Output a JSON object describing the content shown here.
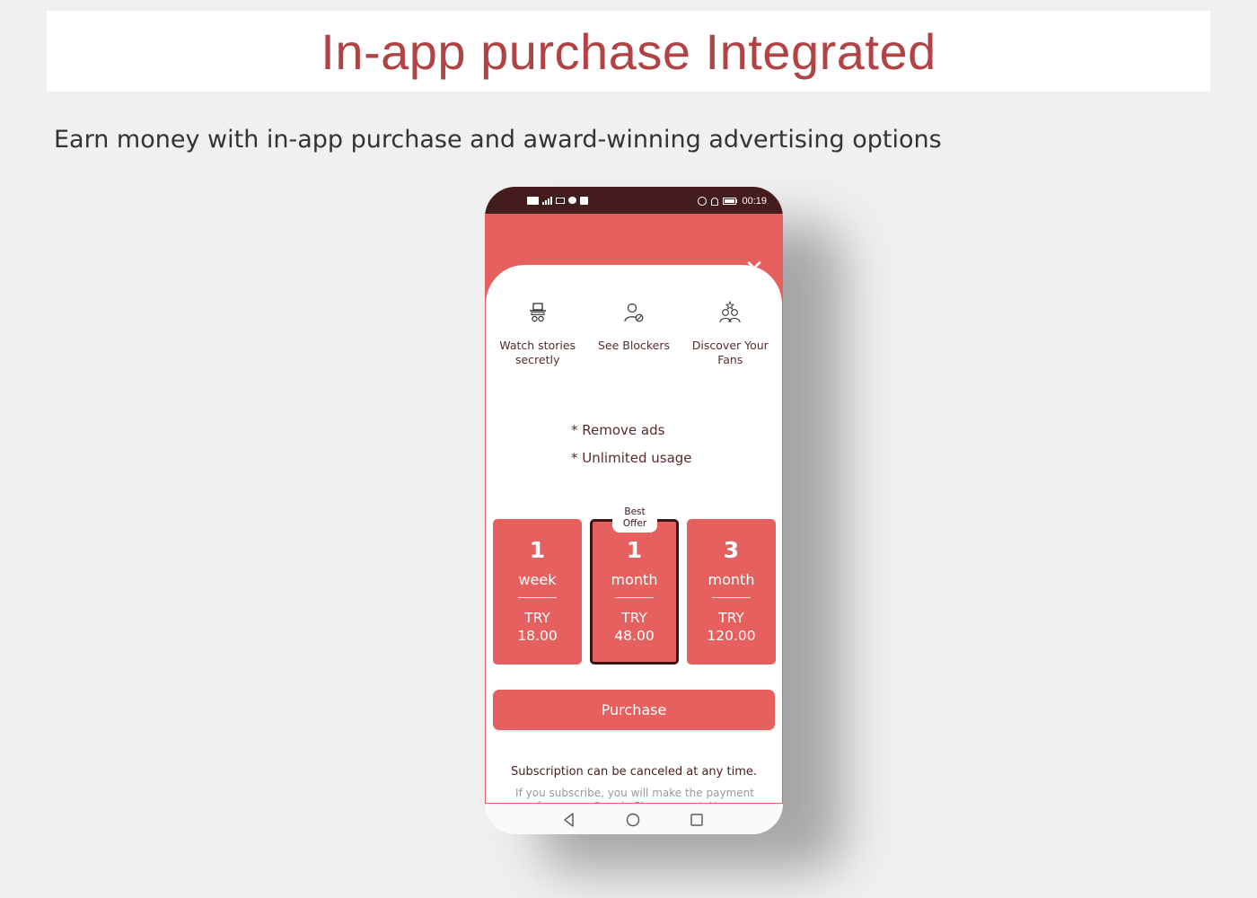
{
  "page": {
    "title": "In-app purchase Integrated",
    "subtitle": "Earn money with in-app purchase and award-winning advertising options"
  },
  "colors": {
    "accent": "#e5605e",
    "title": "#b24345",
    "status_bar": "#451c1e",
    "text_dark": "#5a2a2c",
    "selected_border": "#3c1517"
  },
  "phone": {
    "status_bar": {
      "left_icons": [
        "volte-icon",
        "signal-4g-icon",
        "mail-icon",
        "chat-icon",
        "notification-icon"
      ],
      "right_icons": [
        "alarm-icon",
        "bell-off-icon",
        "battery-icon"
      ],
      "time": "00:19"
    },
    "close_icon": "close-icon",
    "close_glyph": "✕",
    "features": [
      {
        "icon": "spy-hat-icon",
        "label": "Watch stories secretly"
      },
      {
        "icon": "user-blocked-icon",
        "label": "See Blockers"
      },
      {
        "icon": "fans-star-icon",
        "label": "Discover Your Fans"
      }
    ],
    "benefits": [
      "* Remove ads",
      "* Unlimited usage"
    ],
    "plans": [
      {
        "amount": "1",
        "unit": "week",
        "currency": "TRY",
        "price": "18.00",
        "selected": false
      },
      {
        "amount": "1",
        "unit": "month",
        "currency": "TRY",
        "price": "48.00",
        "selected": true,
        "badge": "Best Offer"
      },
      {
        "amount": "3",
        "unit": "month",
        "currency": "TRY",
        "price": "120.00",
        "selected": false
      }
    ],
    "purchase_label": "Purchase",
    "cancel_note": "Subscription can be canceled at any time.",
    "fine_print": "If you subscribe, you will make the payment from your Google Play account. Your",
    "nav": [
      "back-icon",
      "home-icon",
      "recents-icon"
    ]
  }
}
